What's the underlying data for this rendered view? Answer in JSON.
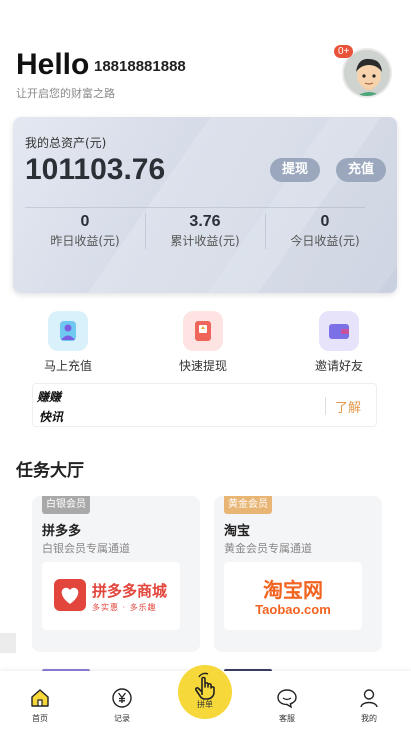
{
  "header": {
    "greeting": "Hello",
    "phone": "18818881888",
    "subtitle": "让开启您的财富之路",
    "avatar_badge": "0+"
  },
  "assets": {
    "label": "我的总资产(元)",
    "total": "101103.76",
    "withdraw_label": "提现",
    "recharge_label": "充值",
    "stats": [
      {
        "value": "0",
        "label": "昨日收益(元)"
      },
      {
        "value": "3.76",
        "label": "累计收益(元)"
      },
      {
        "value": "0",
        "label": "今日收益(元)"
      }
    ]
  },
  "quick_actions": [
    {
      "label": "马上充值",
      "icon": "user-wallet-icon",
      "color": "#6fc8ef"
    },
    {
      "label": "快速提现",
      "icon": "withdraw-card-icon",
      "color": "#f0655a"
    },
    {
      "label": "邀请好友",
      "icon": "invite-card-icon",
      "color": "#7b70e6"
    }
  ],
  "notice": {
    "logo_line1": "赚赚",
    "logo_line2": "快讯",
    "link": "了解"
  },
  "task_hall": {
    "title": "任务大厅",
    "cards": [
      {
        "tag": "白银会员",
        "name": "拼多多",
        "desc": "白银会员专属通道",
        "logo_text": "拼多多商城",
        "logo_sub": "多实惠 · 多乐趣"
      },
      {
        "tag": "黄金会员",
        "name": "淘宝",
        "desc": "黄金会员专属通道",
        "logo_text": "淘宝网",
        "logo_sub": "Taobao.com"
      }
    ]
  },
  "bottom_nav": {
    "home": "首页",
    "record": "记录",
    "center": "拼单",
    "service": "客服",
    "mine": "我的"
  },
  "colors": {
    "accent_yellow": "#f6d83a",
    "badge_red": "#e8533a",
    "link_orange": "#e59a4b"
  }
}
